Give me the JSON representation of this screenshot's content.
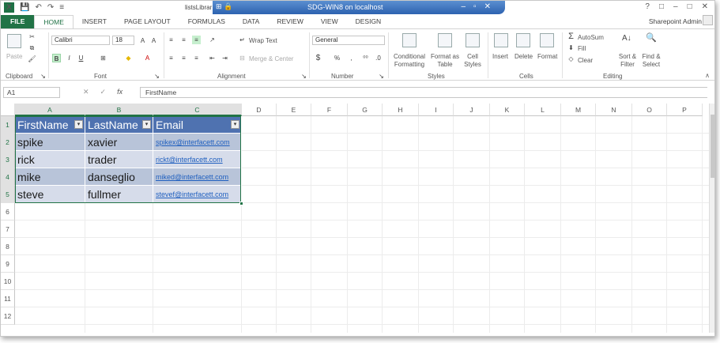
{
  "titlebar": {
    "doc_title": "listsLibrar",
    "remote_title": "SDG-WIN8 on localhost",
    "qat_save": "💾",
    "qat_undo": "↶",
    "qat_redo": "↷",
    "qat_more": "≡"
  },
  "window_controls": {
    "help": "?",
    "restore": "□",
    "minimize": "–",
    "maximize": "□",
    "close": "✕"
  },
  "tabs": [
    "FILE",
    "HOME",
    "INSERT",
    "PAGE LAYOUT",
    "FORMULAS",
    "DATA",
    "REVIEW",
    "VIEW",
    "DESIGN"
  ],
  "active_tab": "HOME",
  "user": "Sharepoint Admin",
  "ribbon": {
    "paste": "Paste",
    "font_name": "Calibri",
    "font_size": "18",
    "bold": "B",
    "italic": "I",
    "underline": "U",
    "wrap_text": "Wrap Text",
    "merge_center": "Merge & Center",
    "number_format": "General",
    "currency": "$",
    "percent": "%",
    "comma": ",",
    "conditional_formatting": "Conditional Formatting",
    "format_as_table": "Format as Table",
    "cell_styles": "Cell Styles",
    "insert": "Insert",
    "delete": "Delete",
    "format": "Format",
    "autosum": "AutoSum",
    "fill": "Fill",
    "clear": "Clear",
    "sort_filter": "Sort & Filter",
    "find_select": "Find & Select",
    "groups": [
      "Clipboard",
      "Font",
      "Alignment",
      "Number",
      "Styles",
      "Cells",
      "Editing"
    ]
  },
  "formula_bar": {
    "name_box": "A1",
    "fx": "fx",
    "content": "FirstName"
  },
  "sheet": {
    "columns": [
      "A",
      "B",
      "C",
      "D",
      "E",
      "F",
      "G",
      "H",
      "I",
      "J",
      "K",
      "L",
      "M",
      "N",
      "O",
      "P"
    ],
    "rows": [
      "1",
      "2",
      "3",
      "4",
      "5",
      "6",
      "7",
      "8",
      "9",
      "10",
      "11",
      "12"
    ],
    "table": {
      "headers": [
        "FirstName",
        "LastName",
        "Email"
      ],
      "rows": [
        [
          "spike",
          "xavier",
          "spikex@interfacett.com"
        ],
        [
          "rick",
          "trader",
          "rickt@interfacett.com"
        ],
        [
          "mike",
          "danseglio",
          "miked@interfacett.com"
        ],
        [
          "steve",
          "fullmer",
          "stevef@interfacett.com"
        ]
      ]
    }
  },
  "colors": {
    "accent": "#217346",
    "table_header": "#4f72b0",
    "band_odd": "#b8c4d9",
    "band_even": "#d6dcea",
    "link": "#1f5fbf"
  }
}
